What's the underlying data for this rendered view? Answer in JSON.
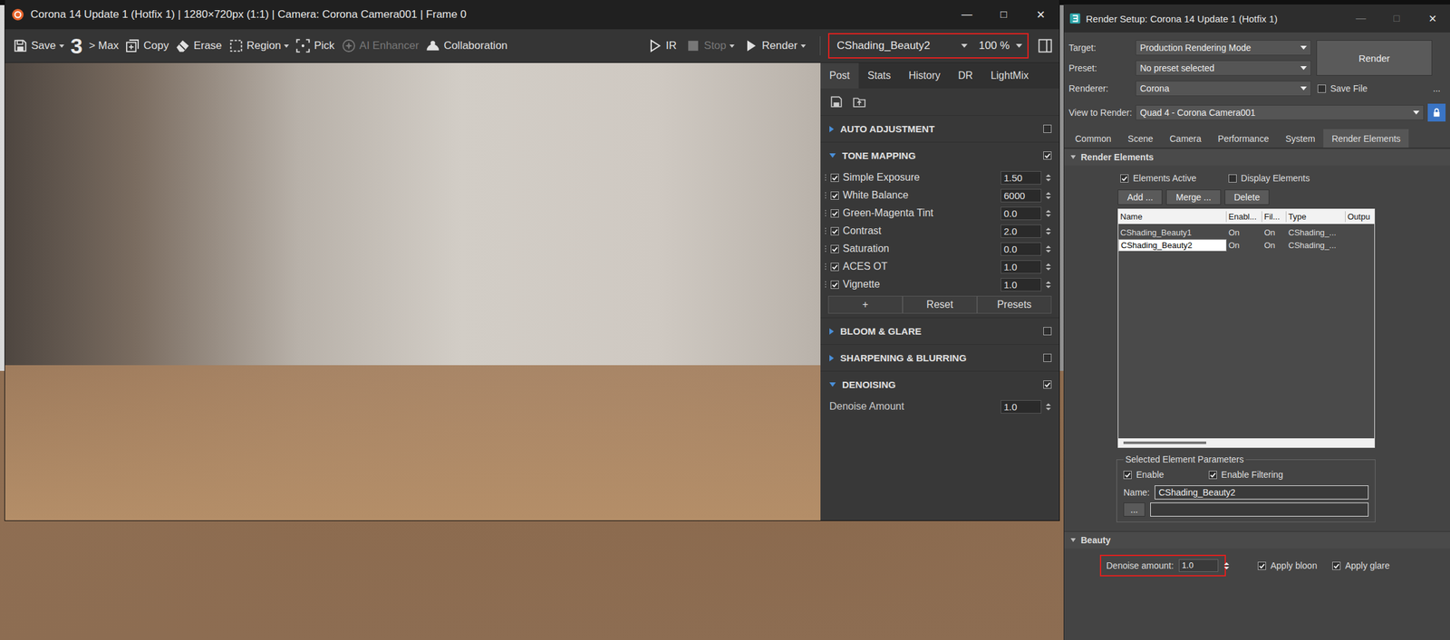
{
  "vfb": {
    "title": "Corona 14 Update 1 (Hotfix 1) | 1280×720px (1:1) | Camera: Corona Camera001 | Frame 0",
    "window_controls": [
      {
        "glyph": "—",
        "disabled": false
      },
      {
        "glyph": "□",
        "disabled": false
      },
      {
        "glyph": "✕",
        "disabled": false
      }
    ],
    "toolbar_left": [
      {
        "label": "Save",
        "kind": "save",
        "dropdown": true,
        "disabled": false
      },
      {
        "label": "3",
        "kind": "logo",
        "dropdown": false,
        "disabled": false
      },
      {
        "label": "> Max",
        "kind": "max",
        "dropdown": false,
        "disabled": false
      },
      {
        "label": "Copy",
        "kind": "copy",
        "dropdown": false,
        "disabled": false
      },
      {
        "label": "Erase",
        "kind": "erase",
        "dropdown": false,
        "disabled": false
      },
      {
        "label": "Region",
        "kind": "region",
        "dropdown": true,
        "disabled": false
      },
      {
        "label": "Pick",
        "kind": "pick",
        "dropdown": false,
        "disabled": false
      },
      {
        "label": "AI Enhancer",
        "kind": "ai",
        "dropdown": false,
        "disabled": true
      },
      {
        "label": "Collaboration",
        "kind": "collab",
        "dropdown": false,
        "disabled": false
      }
    ],
    "toolbar_right": [
      {
        "label": "IR",
        "kind": "ir",
        "dropdown": false,
        "disabled": false
      },
      {
        "label": "Stop",
        "kind": "stop",
        "dropdown": true,
        "disabled": true
      },
      {
        "label": "Render",
        "kind": "render",
        "dropdown": true,
        "disabled": false
      }
    ],
    "element_select": {
      "value": "CShading_Beauty2",
      "highlighted": true
    },
    "zoom": {
      "value": "100 %"
    },
    "panel_tabs": [
      {
        "label": "Post",
        "selected": true
      },
      {
        "label": "Stats",
        "selected": false
      },
      {
        "label": "History",
        "selected": false
      },
      {
        "label": "DR",
        "selected": false
      },
      {
        "label": "LightMix",
        "selected": false
      }
    ],
    "sections": [
      {
        "title": "AUTO ADJUSTMENT",
        "expanded": false,
        "enabled": false,
        "rows": [],
        "buttons": []
      },
      {
        "title": "TONE MAPPING",
        "expanded": true,
        "enabled": true,
        "rows": [
          {
            "label": "Simple Exposure",
            "kind": "check",
            "checked": true,
            "value": "1.50"
          },
          {
            "label": "White Balance",
            "kind": "check",
            "checked": true,
            "value": "6000"
          },
          {
            "label": "Green-Magenta Tint",
            "kind": "check",
            "checked": true,
            "value": "0.0"
          },
          {
            "label": "Contrast",
            "kind": "check",
            "checked": true,
            "value": "2.0"
          },
          {
            "label": "Saturation",
            "kind": "check",
            "checked": true,
            "value": "0.0"
          },
          {
            "label": "ACES OT",
            "kind": "check",
            "checked": true,
            "value": "1.0"
          },
          {
            "label": "Vignette",
            "kind": "check",
            "checked": true,
            "value": "1.0"
          }
        ],
        "buttons": [
          "+",
          "Reset",
          "Presets"
        ]
      },
      {
        "title": "BLOOM & GLARE",
        "expanded": false,
        "enabled": false,
        "rows": [],
        "buttons": []
      },
      {
        "title": "SHARPENING & BLURRING",
        "expanded": false,
        "enabled": false,
        "rows": [],
        "buttons": []
      },
      {
        "title": "DENOISING",
        "expanded": true,
        "enabled": true,
        "rows": [
          {
            "label": "Denoise Amount",
            "kind": "plain",
            "checked": false,
            "value": "1.0"
          }
        ],
        "buttons": []
      }
    ]
  },
  "render_setup": {
    "title": "Render Setup: Corona 14 Update 1 (Hotfix 1)",
    "window_controls": [
      {
        "glyph": "—",
        "disabled": true
      },
      {
        "glyph": "□",
        "disabled": true
      },
      {
        "glyph": "✕",
        "disabled": false
      }
    ],
    "fields": [
      {
        "label": "Target:",
        "value": "Production Rendering Mode"
      },
      {
        "label": "Preset:",
        "value": "No preset selected"
      },
      {
        "label": "Renderer:",
        "value": "Corona"
      }
    ],
    "save_file": {
      "label": "Save File",
      "checked": false
    },
    "more": "...",
    "render_button": "Render",
    "view_to_render": {
      "label": "View to Render:",
      "value": "Quad 4 - Corona Camera001",
      "locked": true
    },
    "tabs": [
      {
        "label": "Common",
        "selected": false
      },
      {
        "label": "Scene",
        "selected": false
      },
      {
        "label": "Camera",
        "selected": false
      },
      {
        "label": "Performance",
        "selected": false
      },
      {
        "label": "System",
        "selected": false
      },
      {
        "label": "Render Elements",
        "selected": true
      }
    ],
    "elements_rollout": {
      "title": "Render Elements",
      "expanded": true,
      "elements_active": {
        "label": "Elements Active",
        "checked": true
      },
      "display_elements": {
        "label": "Display Elements",
        "checked": false
      },
      "buttons": [
        "Add ...",
        "Merge ...",
        "Delete"
      ],
      "table": {
        "columns": [
          "Name",
          "Enabl...",
          "Fil...",
          "Type",
          "Outpu"
        ],
        "rows": [
          {
            "cells": [
              "CShading_Beauty1",
              "On",
              "On",
              "CShading_..."
            ],
            "selected": false
          },
          {
            "cells": [
              "CShading_Beauty2",
              "On",
              "On",
              "CShading_..."
            ],
            "selected": true
          }
        ]
      },
      "params": {
        "title": "Selected Element Parameters",
        "enable": {
          "label": "Enable",
          "checked": true
        },
        "enable_filtering": {
          "label": "Enable Filtering",
          "checked": true
        },
        "name_label": "Name:",
        "name_value": "CShading_Beauty2",
        "browse": "...",
        "path": ""
      }
    },
    "beauty_rollout": {
      "title": "Beauty",
      "expanded": true,
      "denoise": {
        "label": "Denoise amount:",
        "value": "1.0",
        "highlighted": true
      },
      "apply_bloom": {
        "label": "Apply bloon",
        "checked": true
      },
      "apply_glare": {
        "label": "Apply glare",
        "checked": true
      }
    }
  }
}
